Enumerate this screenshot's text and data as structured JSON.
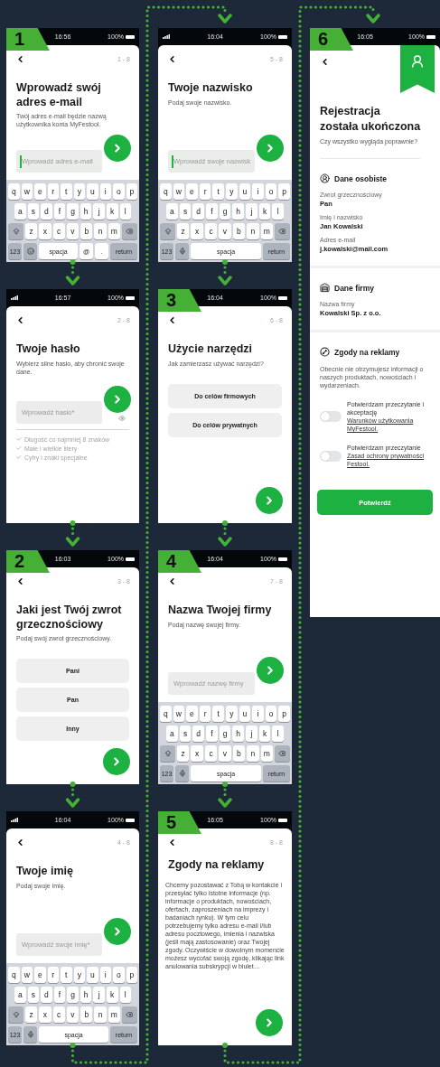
{
  "columns": [
    {
      "screens": [
        {
          "kind": "input",
          "badge": "1",
          "status": {
            "time": "16:56",
            "battery": "100%"
          },
          "counter": "1 - 8",
          "title": "Wprowadź swój adres e-mail",
          "subtitle": "Twój adres e-mail będzie nazwą użytkownika konta MyFestool.",
          "field": {
            "kind": "text",
            "placeholder": "Wprowadź adres e-mail",
            "focused": true
          },
          "keyboard": {
            "rows": [
              [
                "q",
                "w",
                "e",
                "r",
                "t",
                "y",
                "u",
                "i",
                "o",
                "p"
              ],
              [
                "a",
                "s",
                "d",
                "f",
                "g",
                "h",
                "j",
                "k",
                "l"
              ],
              [
                "z",
                "x",
                "c",
                "v",
                "b",
                "n",
                "m"
              ]
            ],
            "bottom": [
              {
                "kind": "fn",
                "label": "123"
              },
              {
                "kind": "emoji"
              },
              {
                "kind": "space",
                "label": "spacja"
              },
              {
                "kind": "key",
                "label": "@"
              },
              {
                "kind": "key",
                "label": "."
              },
              {
                "kind": "return",
                "label": "return"
              }
            ]
          }
        },
        {
          "kind": "input",
          "status": {
            "time": "16:57",
            "battery": "100%"
          },
          "counter": "2 - 8",
          "title": "Twoje hasło",
          "subtitle": "Wybierz silne hasło, aby chronić swoje dane.",
          "field": {
            "kind": "password",
            "placeholder": "Wprowadź hasło*",
            "focused": false
          },
          "rules": [
            {
              "text": "Długość co najmniej 8 znaków",
              "met": false
            },
            {
              "text": "Małe i wielkie litery",
              "met": false
            },
            {
              "text": "Cyfry i znaki specjalne",
              "met": false
            }
          ]
        },
        {
          "kind": "options",
          "badge": "2",
          "status": {
            "time": "16:03",
            "battery": "100%"
          },
          "counter": "3 - 8",
          "title": "Jaki jest Twój zwrot grzecznościowy",
          "subtitle": "Podaj swój zwrot grzecznościowy.",
          "options": [
            "Pani",
            "Pan",
            "Inny"
          ]
        },
        {
          "kind": "input",
          "status": {
            "time": "16:04",
            "battery": "100%"
          },
          "counter": "4 - 8",
          "title": "Twoje imię",
          "subtitle": "Podaj swoje imię.",
          "field": {
            "kind": "text",
            "placeholder": "Wprowadź swoje imię*",
            "focused": false
          },
          "keyboard": {
            "rows": [
              [
                "q",
                "w",
                "e",
                "r",
                "t",
                "y",
                "u",
                "i",
                "o",
                "p"
              ],
              [
                "a",
                "s",
                "d",
                "f",
                "g",
                "h",
                "j",
                "k",
                "l"
              ],
              [
                "z",
                "x",
                "c",
                "v",
                "b",
                "n",
                "m"
              ]
            ],
            "bottom": [
              {
                "kind": "fn",
                "label": "123"
              },
              {
                "kind": "mic"
              },
              {
                "kind": "space",
                "label": "spacja"
              },
              {
                "kind": "return",
                "label": "return"
              }
            ]
          }
        }
      ]
    },
    {
      "screens": [
        {
          "kind": "input",
          "status": {
            "time": "16:04",
            "battery": "100%"
          },
          "counter": "5 - 8",
          "title": "Twoje nazwisko",
          "subtitle": "Podaj swoje nazwisko.",
          "field": {
            "kind": "text",
            "placeholder": "Wprowadź swoje nazwisk",
            "focused": true
          },
          "keyboard": {
            "rows": [
              [
                "q",
                "w",
                "e",
                "r",
                "t",
                "y",
                "u",
                "i",
                "o",
                "p"
              ],
              [
                "a",
                "s",
                "d",
                "f",
                "g",
                "h",
                "j",
                "k",
                "l"
              ],
              [
                "z",
                "x",
                "c",
                "v",
                "b",
                "n",
                "m"
              ]
            ],
            "bottom": [
              {
                "kind": "fn",
                "label": "123"
              },
              {
                "kind": "mic"
              },
              {
                "kind": "space",
                "label": "spacja"
              },
              {
                "kind": "return",
                "label": "return"
              }
            ]
          }
        },
        {
          "kind": "options",
          "badge": "3",
          "status": {
            "time": "16:04",
            "battery": "100%"
          },
          "counter": "6 - 8",
          "title": "Użycie narzędzi",
          "subtitle": "Jak zamierzasz używać narzędzi?",
          "options": [
            "Do celów firmowych",
            "Do celów prywatnych"
          ]
        },
        {
          "kind": "input",
          "badge": "4",
          "status": {
            "time": "16:04",
            "battery": "100%"
          },
          "counter": "7 - 8",
          "title": "Nazwa Twojej firmy",
          "subtitle": "Podaj nazwę swojej firmy.",
          "field": {
            "kind": "text",
            "placeholder": "Wprowadź nazwę firmy",
            "focused": false
          },
          "keyboard": {
            "rows": [
              [
                "q",
                "w",
                "e",
                "r",
                "t",
                "y",
                "u",
                "i",
                "o",
                "p"
              ],
              [
                "a",
                "s",
                "d",
                "f",
                "g",
                "h",
                "j",
                "k",
                "l"
              ],
              [
                "z",
                "x",
                "c",
                "v",
                "b",
                "n",
                "m"
              ]
            ],
            "bottom": [
              {
                "kind": "fn",
                "label": "123"
              },
              {
                "kind": "mic"
              },
              {
                "kind": "space",
                "label": "spacja"
              },
              {
                "kind": "return",
                "label": "return"
              }
            ]
          }
        },
        {
          "kind": "text",
          "badge": "5",
          "status": {
            "time": "16:05",
            "battery": "100%"
          },
          "counter": "8 - 8",
          "title": "Zgody na reklamy",
          "body": "Chcemy pozostawać z Tobą w kontakcie i przesyłać tylko istotne informacje (np. informacje o produktach, nowościach, ofertach, zaproszeniach na imprezy i badaniach rynku). W tym celu potrzebujemy tylko adresu e-mail i/lub adresu pocztowego, imienia i nazwiska (jeśli mają zastosowanie) oraz Twojej zgody. Oczywiście w dowolnym momencie możesz wycofać swoją zgodę, klikając link anulowania subskrypcji w biulet…"
        }
      ]
    },
    {
      "screens": [
        {
          "kind": "summary",
          "badge": "6",
          "status": {
            "time": "16:05",
            "battery": "100%"
          },
          "title": "Rejestracja została ukończona",
          "subtitle": "Czy wszystko wygląda poprawnie?",
          "sections": [
            {
              "kind": "personal",
              "heading": "Dane osobiste",
              "fields": [
                {
                  "label": "Zwrot grzecznościowy",
                  "value": "Pan"
                },
                {
                  "label": "Imię i nazwisko",
                  "value": "Jan Kowalski"
                },
                {
                  "label": "Adres e-mail",
                  "value": "j.kowalski@mail.com"
                }
              ]
            },
            {
              "kind": "company",
              "heading": "Dane firmy",
              "fields": [
                {
                  "label": "Nazwa firmy",
                  "value": "Kowalski Sp. z o.o."
                }
              ]
            },
            {
              "kind": "consents",
              "heading": "Zgody na reklamy",
              "text": "Obecnie nie otrzymujesz informacji o naszych produktach, nowościach i wydarzeniach.",
              "consents": [
                {
                  "text": "Potwierdzam przeczytanie i akceptację",
                  "link": "Warunków użytkowania MyFestool.",
                  "on": false
                },
                {
                  "text": "Potwierdzam przeczytanie",
                  "link": "Zasad ochrony prywatności Festool.",
                  "on": false
                }
              ]
            }
          ],
          "confirm": "Potwierdź"
        }
      ]
    }
  ]
}
